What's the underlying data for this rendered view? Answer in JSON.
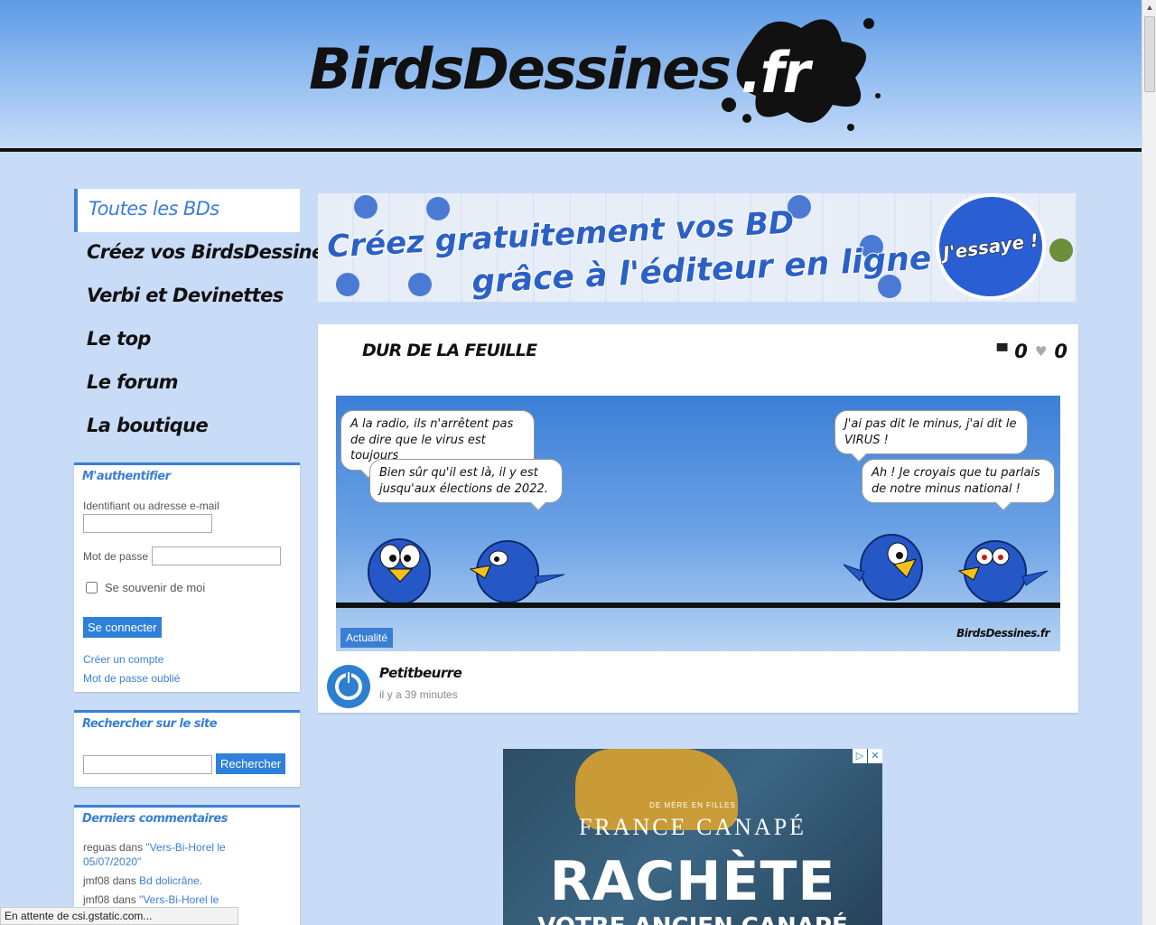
{
  "header": {
    "logo_text": "BirdsDessines",
    "logo_tld": ".fr"
  },
  "nav": {
    "items": [
      {
        "label": "Toutes les BDs",
        "active": true
      },
      {
        "label": "Créez vos BirdsDessinés"
      },
      {
        "label": "Verbi et Devinettes"
      },
      {
        "label": "Le top"
      },
      {
        "label": "Le forum"
      },
      {
        "label": "La boutique"
      }
    ]
  },
  "login": {
    "title": "M'authentifier",
    "username_label": "Identifiant ou adresse e-mail",
    "username_value": "",
    "password_label": "Mot de passe",
    "password_value": "",
    "remember_label": "Se souvenir de moi",
    "remember_checked": false,
    "submit_label": "Se connecter",
    "create_account": "Créer un compte",
    "forgot_password": "Mot de passe oublié"
  },
  "search": {
    "title": "Rechercher sur le site",
    "value": "",
    "button": "Rechercher"
  },
  "comments": {
    "title": "Derniers commentaires",
    "items": [
      {
        "user": "reguas",
        "sep": "dans",
        "post": "\"Vers-Bi-Horel le 05/07/2020\""
      },
      {
        "user": "jmf08",
        "sep": "dans",
        "post": "Bd dolicrâne."
      },
      {
        "user": "jmf08",
        "sep": "dans",
        "post": "\"Vers-Bi-Horel le"
      }
    ]
  },
  "banner": {
    "line1": "Créez gratuitement vos BD",
    "line2": "grâce à l'éditeur en ligne !",
    "cta": "J'essaye !"
  },
  "post": {
    "title": "DUR DE LA FEUILLE",
    "comment_count": "0",
    "like_count": "0",
    "comic": {
      "bubble1": "A la radio, ils n'arrêtent pas de dire que le virus est toujours",
      "bubble2": "Bien sûr qu'il est là, il y est jusqu'aux élections de 2022.",
      "bubble3": "J'ai pas dit le minus, j'ai dit le VIRUS !",
      "bubble4": "Ah ! Je croyais que tu parlais de notre minus national !",
      "tag": "Actualité",
      "brand": "BirdsDessines.fr"
    },
    "author": "Petitbeurre",
    "time": "il y a 39 minutes"
  },
  "ad": {
    "small": "DE MÈRE EN FILLES",
    "brand": "FRANCE CANAPÉ",
    "headline": "RACHÈTE",
    "sub": "VOTRE ANCIEN CANAPÉ"
  },
  "status": {
    "text": "En attente de csi.gstatic.com..."
  },
  "colors": {
    "accent": "#3a7fd5",
    "page_bg": "#c9dcf7"
  }
}
